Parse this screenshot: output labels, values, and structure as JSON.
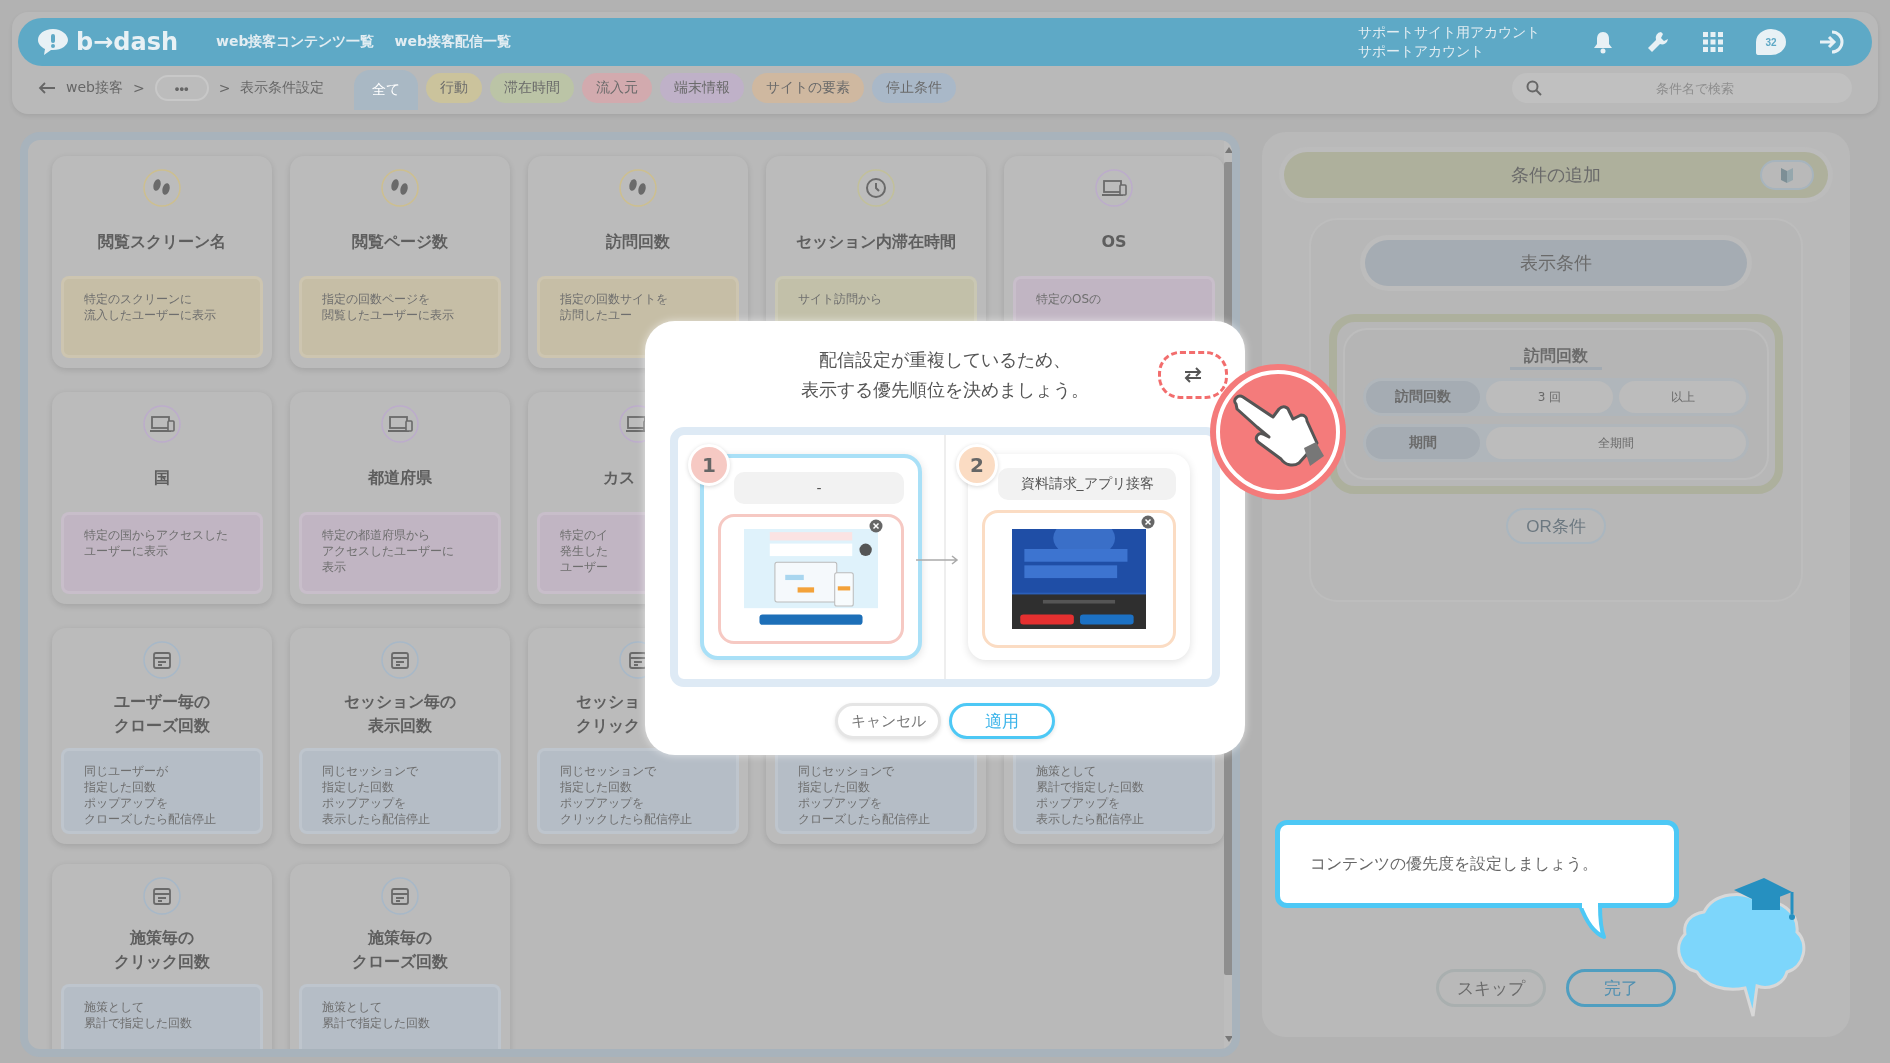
{
  "header": {
    "logo": "b→dash",
    "nav": [
      "web接客コンテンツ一覧",
      "web接客配信一覧"
    ],
    "account": [
      "サポートサイト用アカウント",
      "サポートアカウント"
    ],
    "chat_count": "32"
  },
  "breadcrumb": [
    {
      "kind": "link",
      "text": "web接客"
    },
    {
      "kind": "sep",
      "text": ">"
    },
    {
      "kind": "more",
      "text": "•••"
    },
    {
      "kind": "sep",
      "text": ">"
    },
    {
      "kind": "current",
      "text": "表示条件設定"
    }
  ],
  "filter_tabs": [
    {
      "label": "全て",
      "selected": true,
      "color": "#a9b8c4"
    },
    {
      "label": "行動",
      "selected": false,
      "color": "#cbc39c"
    },
    {
      "label": "滞在時間",
      "selected": false,
      "color": "#bbc4a6"
    },
    {
      "label": "流入元",
      "selected": false,
      "color": "#d2aaae"
    },
    {
      "label": "端末情報",
      "selected": false,
      "color": "#bfb1c8"
    },
    {
      "label": "サイトの要素",
      "selected": false,
      "color": "#cfb8a0"
    },
    {
      "label": "停止条件",
      "selected": false,
      "color": "#a9b8c8"
    }
  ],
  "search": {
    "placeholder": "条件名で検索"
  },
  "card_rows": [
    [
      {
        "kind": "footprints",
        "title": [
          "閲覧スクリーン名"
        ],
        "desc": [
          "特定のスクリーンに",
          "流入したユーザーに表示"
        ],
        "color": "#c6bea6"
      },
      {
        "kind": "footprints",
        "title": [
          "閲覧ページ数"
        ],
        "desc": [
          "指定の回数ページを",
          "閲覧したユーザーに表示"
        ],
        "color": "#c6bea6"
      },
      {
        "kind": "footprints",
        "title": [
          "訪問回数"
        ],
        "desc": [
          "指定の回数サイトを",
          "訪問したユー"
        ],
        "color": "#c6bea6"
      },
      {
        "kind": "clock",
        "title": [
          "セッション内滞在時間"
        ],
        "desc": [
          "サイト訪問から"
        ],
        "color": "#c2c0a9"
      },
      {
        "kind": "monitor",
        "title": [
          "OS"
        ],
        "desc": [
          "特定のOSの"
        ],
        "color": "#c1b5c3"
      }
    ],
    [
      {
        "kind": "monitor",
        "title": [
          "国"
        ],
        "desc": [
          "特定の国からアクセスした",
          "ユーザーに表示"
        ],
        "color": "#c1b5c3"
      },
      {
        "kind": "monitor",
        "title": [
          "都道府県"
        ],
        "desc": [
          "特定の都道府県から",
          "アクセスしたユーザーに",
          "表示"
        ],
        "color": "#c1b5c3"
      },
      {
        "kind": "monitor",
        "title": [
          "カス"
        ],
        "desc": [
          "特定のイ",
          "発生した",
          "ユーザー"
        ],
        "color": "#c1b5c3"
      }
    ],
    [
      {
        "kind": "calendar",
        "title": [
          "ユーザー毎の",
          "クローズ回数"
        ],
        "desc": [
          "同じユーザーが",
          "指定した回数",
          "ポップアップを",
          "クローズしたら配信停止"
        ],
        "color": "#b5bdc6"
      },
      {
        "kind": "calendar",
        "title": [
          "セッション毎の",
          "表示回数"
        ],
        "desc": [
          "同じセッションで",
          "指定した回数",
          "ポップアップを",
          "表示したら配信停止"
        ],
        "color": "#b5bdc6"
      },
      {
        "kind": "calendar",
        "title": [
          "セッショ",
          "クリック"
        ],
        "desc": [
          "同じセッションで",
          "指定した回数",
          "ポップアップを",
          "クリックしたら配信停止"
        ],
        "color": "#b5bdc6"
      },
      {
        "desc": [
          "同じセッションで",
          "指定した回数",
          "ポップアップを",
          "クローズしたら配信停止"
        ],
        "color": "#b5bdc6"
      },
      {
        "desc": [
          "施策として",
          "累計で指定した回数",
          "ポップアップを",
          "表示したら配信停止"
        ],
        "color": "#b5bdc6"
      }
    ],
    [
      {
        "kind": "calendar",
        "title": [
          "施策毎の",
          "クリック回数"
        ],
        "desc": [
          "施策として",
          "累計で指定した回数"
        ],
        "color": "#b5bdc6"
      },
      {
        "kind": "calendar",
        "title": [
          "施策毎の",
          "クローズ回数"
        ],
        "desc": [
          "施策として",
          "累計で指定した回数"
        ],
        "color": "#b5bdc6"
      }
    ]
  ],
  "side_panel": {
    "add_title": "条件の追加",
    "display_title": "表示条件",
    "condition": {
      "title": "訪問回数",
      "rows": [
        {
          "label": "訪問回数",
          "values": [
            "3 回",
            "以上"
          ]
        },
        {
          "label": "期間",
          "values": [
            "全期間"
          ]
        }
      ]
    },
    "or_button": "OR条件",
    "buttons": [
      {
        "label": "スキップ",
        "kind": "secondary"
      },
      {
        "label": "完了",
        "kind": "primary"
      }
    ]
  },
  "dialog": {
    "message_lines": [
      "配信設定が重複しているため、",
      "表示する優先順位を決めましょう。"
    ],
    "items": [
      {
        "number": "1",
        "name": "-",
        "selected": true,
        "color": "#f6c9c3"
      },
      {
        "number": "2",
        "name": "資料請求_アプリ接客",
        "selected": false,
        "color": "#fbdcc3"
      }
    ],
    "buttons": [
      {
        "label": "キャンセル",
        "kind": "secondary"
      },
      {
        "label": "適用",
        "kind": "primary"
      }
    ]
  },
  "tooltip": {
    "text": "コンテンツの優先度を設定しましょう。"
  }
}
